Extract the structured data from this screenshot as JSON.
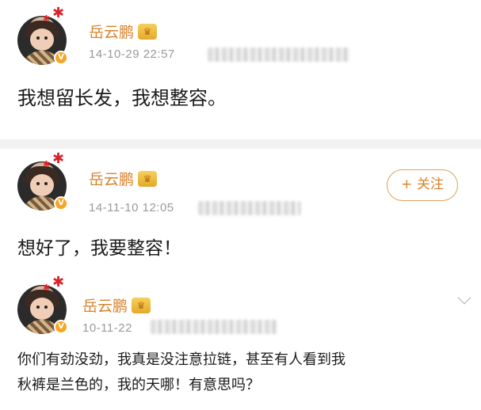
{
  "posts": [
    {
      "username": "岳云鹏",
      "time": "14-10-29 22:57",
      "text": "我想留长发，我想整容。"
    },
    {
      "username": "岳云鹏",
      "time": "14-11-10 12:05",
      "text": "想好了，我要整容！",
      "follow_label": "+ 关注"
    },
    {
      "username": "岳云鹏",
      "time": "10-11-22",
      "text_line1": "你们有劲没劲，我真是没注意拉链，甚至有人看到我",
      "text_line2": "秋裤是兰色的，我的天哪！有意思吗？"
    }
  ],
  "colors": {
    "username": "#d9822b",
    "time": "#9a9a9a",
    "follow_border": "#d9a45a",
    "divider": "#f2f2f2"
  },
  "icons": [
    "avatar",
    "red-flower-icon",
    "verified-badge-icon",
    "crown-icon",
    "chevron-down-icon"
  ]
}
